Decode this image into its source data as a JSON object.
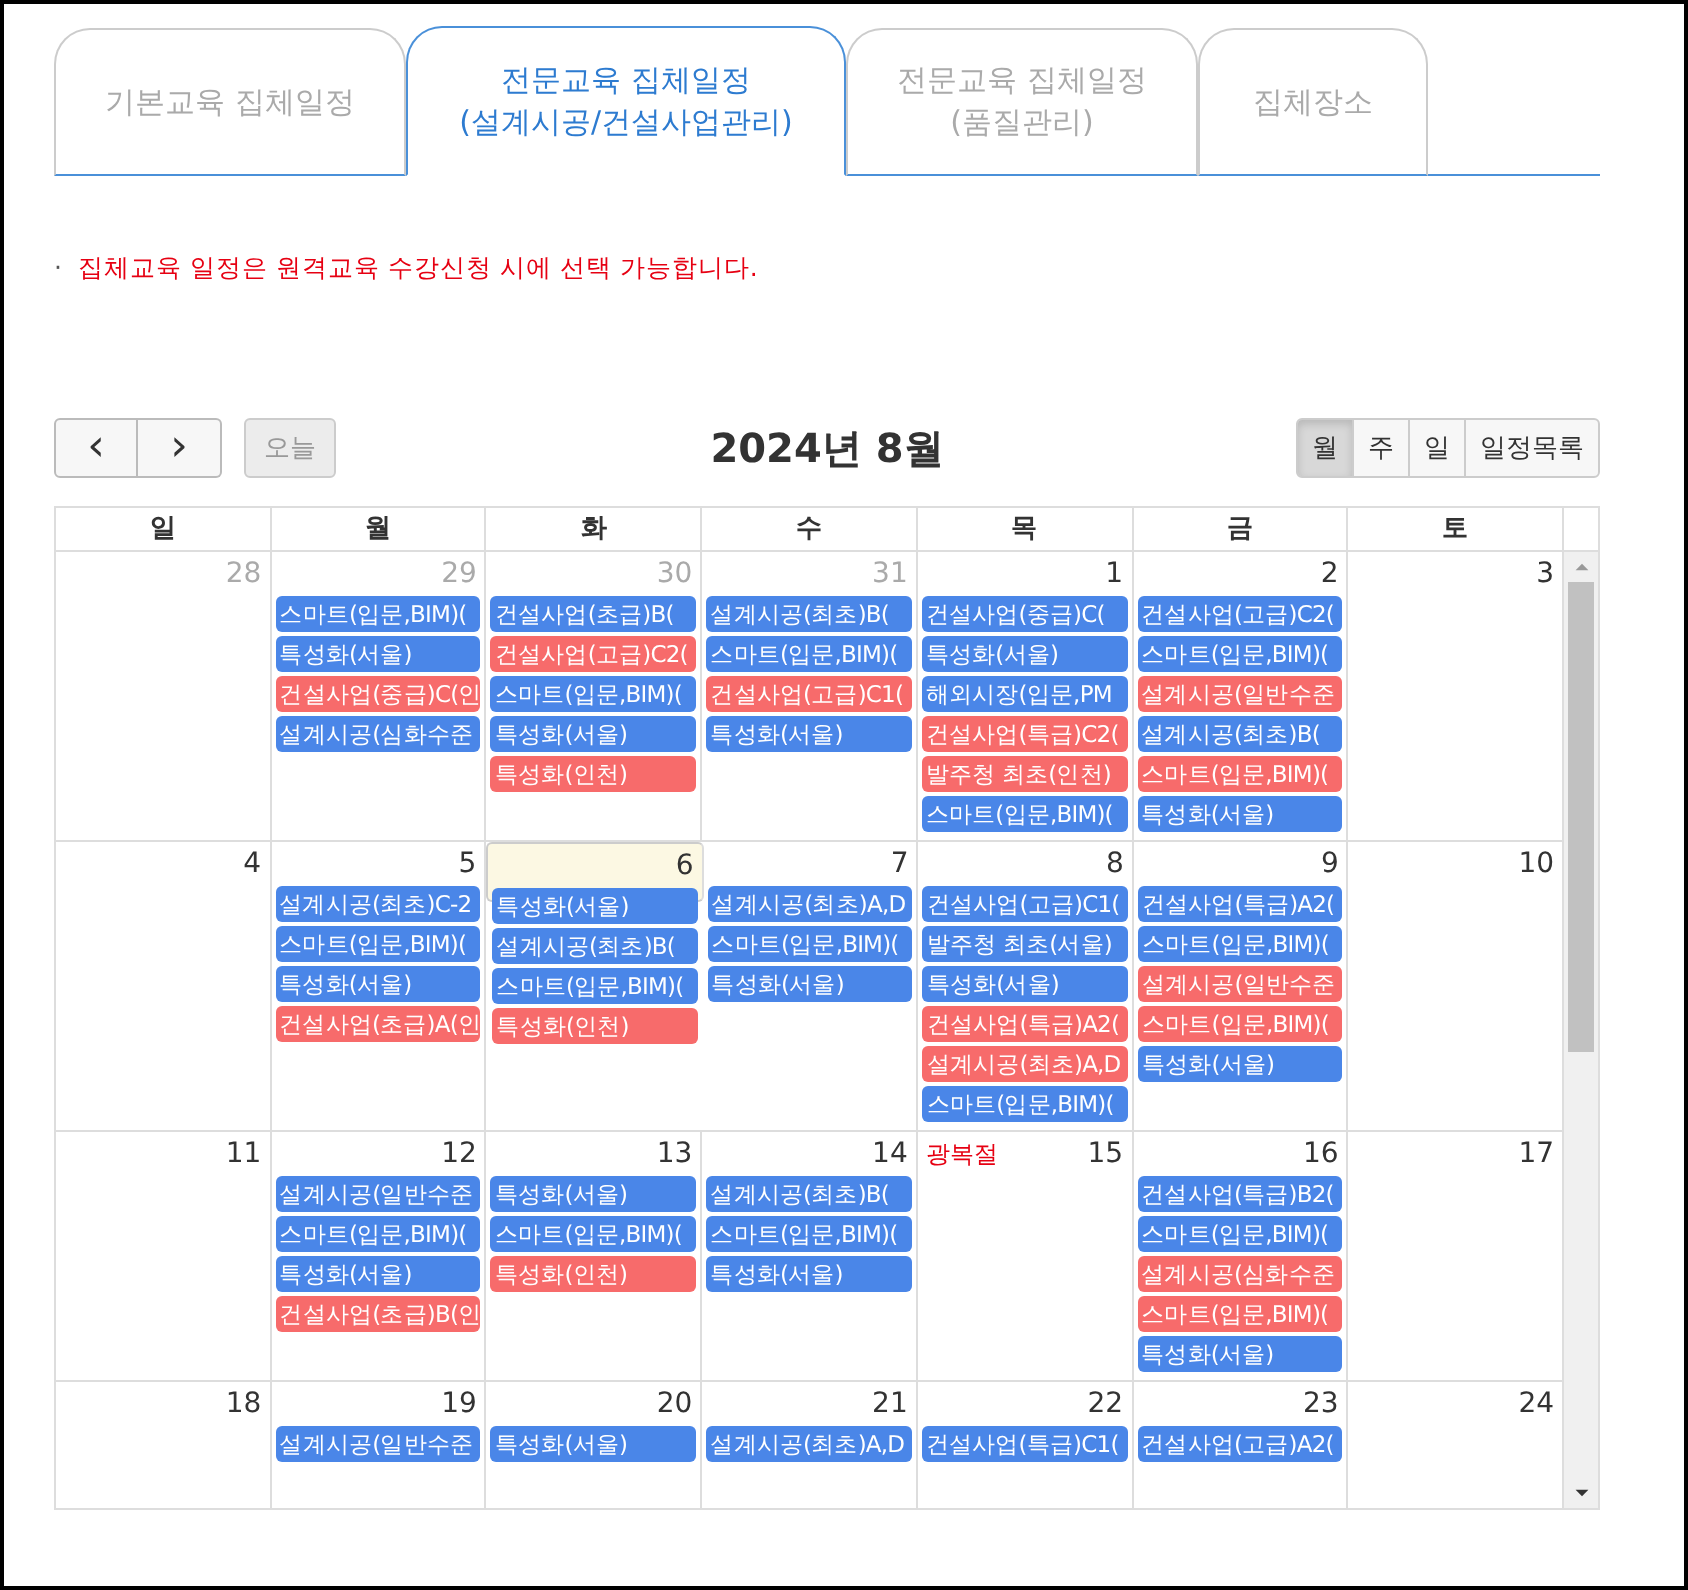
{
  "tabs": [
    {
      "lines": [
        "기본교육 집체일정"
      ],
      "selected": false
    },
    {
      "lines": [
        "전문교육 집체일정",
        "(설계시공/건설사업관리)"
      ],
      "selected": true
    },
    {
      "lines": [
        "전문교육 집체일정",
        "(품질관리)"
      ],
      "selected": false
    },
    {
      "lines": [
        "집체장소"
      ],
      "selected": false
    }
  ],
  "notice": {
    "bullet": "·",
    "text": "집체교육 일정은 원격교육 수강신청 시에 선택 가능합니다."
  },
  "toolbar": {
    "prev": "‹",
    "next": "›",
    "today": {
      "label": "오늘",
      "disabled": true
    },
    "title": "2024년 8월",
    "views": [
      {
        "label": "월",
        "selected": true
      },
      {
        "label": "주",
        "selected": false
      },
      {
        "label": "일",
        "selected": false
      },
      {
        "label": "일정목록",
        "selected": false
      }
    ]
  },
  "weekdays": [
    "일",
    "월",
    "화",
    "수",
    "목",
    "금",
    "토"
  ],
  "weeks": [
    {
      "days": [
        {
          "date": "28",
          "muted": true,
          "today": false
        },
        {
          "date": "29",
          "muted": true,
          "today": false,
          "events": [
            {
              "text": "스마트(입문,BIM)(",
              "color": "#4a86e8"
            },
            {
              "text": "특성화(서울)",
              "color": "#4a86e8"
            },
            {
              "text": "건설사업(중급)C(인",
              "color": "#f76b6b"
            },
            {
              "text": "설계시공(심화수준",
              "color": "#4a86e8"
            }
          ]
        },
        {
          "date": "30",
          "muted": true,
          "today": false,
          "events": [
            {
              "text": "건설사업(초급)B(",
              "color": "#4a86e8"
            },
            {
              "text": "건설사업(고급)C2(",
              "color": "#f76b6b"
            },
            {
              "text": "스마트(입문,BIM)(",
              "color": "#4a86e8"
            },
            {
              "text": "특성화(서울)",
              "color": "#4a86e8"
            },
            {
              "text": "특성화(인천)",
              "color": "#f76b6b"
            }
          ]
        },
        {
          "date": "31",
          "muted": true,
          "today": false,
          "events": [
            {
              "text": "설계시공(최초)B(",
              "color": "#4a86e8"
            },
            {
              "text": "스마트(입문,BIM)(",
              "color": "#4a86e8"
            },
            {
              "text": "건설사업(고급)C1(",
              "color": "#f76b6b"
            },
            {
              "text": "특성화(서울)",
              "color": "#4a86e8"
            }
          ]
        },
        {
          "date": "1",
          "muted": false,
          "today": false,
          "events": [
            {
              "text": "건설사업(중급)C(",
              "color": "#4a86e8"
            },
            {
              "text": "특성화(서울)",
              "color": "#4a86e8"
            },
            {
              "text": "해외시장(입문,PM",
              "color": "#4a86e8"
            },
            {
              "text": "건설사업(특급)C2(",
              "color": "#f76b6b"
            },
            {
              "text": "발주청 최초(인천)",
              "color": "#f76b6b"
            },
            {
              "text": "스마트(입문,BIM)(",
              "color": "#4a86e8"
            }
          ]
        },
        {
          "date": "2",
          "muted": false,
          "today": false,
          "events": [
            {
              "text": "건설사업(고급)C2(",
              "color": "#4a86e8"
            },
            {
              "text": "스마트(입문,BIM)(",
              "color": "#4a86e8"
            },
            {
              "text": "설계시공(일반수준",
              "color": "#f76b6b"
            },
            {
              "text": "설계시공(최초)B(",
              "color": "#4a86e8"
            },
            {
              "text": "스마트(입문,BIM)(",
              "color": "#f76b6b"
            },
            {
              "text": "특성화(서울)",
              "color": "#4a86e8"
            }
          ]
        },
        {
          "date": "3",
          "muted": false,
          "today": false
        }
      ]
    },
    {
      "days": [
        {
          "date": "4",
          "muted": false,
          "today": false
        },
        {
          "date": "5",
          "muted": false,
          "today": false,
          "events": [
            {
              "text": "설계시공(최초)C-2",
              "color": "#4a86e8"
            },
            {
              "text": "스마트(입문,BIM)(",
              "color": "#4a86e8"
            },
            {
              "text": "특성화(서울)",
              "color": "#4a86e8"
            },
            {
              "text": "건설사업(초급)A(인",
              "color": "#f76b6b"
            }
          ]
        },
        {
          "date": "6",
          "muted": false,
          "today": true,
          "events": [
            {
              "text": "특성화(서울)",
              "color": "#4a86e8"
            },
            {
              "text": "설계시공(최초)B(",
              "color": "#4a86e8"
            },
            {
              "text": "스마트(입문,BIM)(",
              "color": "#4a86e8"
            },
            {
              "text": "특성화(인천)",
              "color": "#f76b6b"
            }
          ]
        },
        {
          "date": "7",
          "muted": false,
          "today": false,
          "events": [
            {
              "text": "설계시공(최초)A,D",
              "color": "#4a86e8"
            },
            {
              "text": "스마트(입문,BIM)(",
              "color": "#4a86e8"
            },
            {
              "text": "특성화(서울)",
              "color": "#4a86e8"
            }
          ]
        },
        {
          "date": "8",
          "muted": false,
          "today": false,
          "events": [
            {
              "text": "건설사업(고급)C1(",
              "color": "#4a86e8"
            },
            {
              "text": "발주청 최초(서울)",
              "color": "#4a86e8"
            },
            {
              "text": "특성화(서울)",
              "color": "#4a86e8"
            },
            {
              "text": "건설사업(특급)A2(",
              "color": "#f76b6b"
            },
            {
              "text": "설계시공(최초)A,D",
              "color": "#f76b6b"
            },
            {
              "text": "스마트(입문,BIM)(",
              "color": "#4a86e8"
            }
          ]
        },
        {
          "date": "9",
          "muted": false,
          "today": false,
          "events": [
            {
              "text": "건설사업(특급)A2(",
              "color": "#4a86e8"
            },
            {
              "text": "스마트(입문,BIM)(",
              "color": "#4a86e8"
            },
            {
              "text": "설계시공(일반수준",
              "color": "#f76b6b"
            },
            {
              "text": "스마트(입문,BIM)(",
              "color": "#f76b6b"
            },
            {
              "text": "특성화(서울)",
              "color": "#4a86e8"
            }
          ]
        },
        {
          "date": "10",
          "muted": false,
          "today": false
        }
      ]
    },
    {
      "days": [
        {
          "date": "11",
          "muted": false,
          "today": false
        },
        {
          "date": "12",
          "muted": false,
          "today": false,
          "events": [
            {
              "text": "설계시공(일반수준",
              "color": "#4a86e8"
            },
            {
              "text": "스마트(입문,BIM)(",
              "color": "#4a86e8"
            },
            {
              "text": "특성화(서울)",
              "color": "#4a86e8"
            },
            {
              "text": "건설사업(초급)B(인",
              "color": "#f76b6b"
            }
          ]
        },
        {
          "date": "13",
          "muted": false,
          "today": false,
          "events": [
            {
              "text": "특성화(서울)",
              "color": "#4a86e8"
            },
            {
              "text": "스마트(입문,BIM)(",
              "color": "#4a86e8"
            },
            {
              "text": "특성화(인천)",
              "color": "#f76b6b"
            }
          ]
        },
        {
          "date": "14",
          "muted": false,
          "today": false,
          "events": [
            {
              "text": "설계시공(최초)B(",
              "color": "#4a86e8"
            },
            {
              "text": "스마트(입문,BIM)(",
              "color": "#4a86e8"
            },
            {
              "text": "특성화(서울)",
              "color": "#4a86e8"
            }
          ]
        },
        {
          "date": "15",
          "muted": false,
          "today": false,
          "holiday": "광복절"
        },
        {
          "date": "16",
          "muted": false,
          "today": false,
          "events": [
            {
              "text": "건설사업(특급)B2(",
              "color": "#4a86e8"
            },
            {
              "text": "스마트(입문,BIM)(",
              "color": "#4a86e8"
            },
            {
              "text": "설계시공(심화수준",
              "color": "#f76b6b"
            },
            {
              "text": "스마트(입문,BIM)(",
              "color": "#f76b6b"
            },
            {
              "text": "특성화(서울)",
              "color": "#4a86e8"
            }
          ]
        },
        {
          "date": "17",
          "muted": false,
          "today": false
        }
      ]
    },
    {
      "days": [
        {
          "date": "18",
          "muted": false,
          "today": false
        },
        {
          "date": "19",
          "muted": false,
          "today": false,
          "events": [
            {
              "text": "설계시공(일반수준",
              "color": "#4a86e8"
            }
          ]
        },
        {
          "date": "20",
          "muted": false,
          "today": false,
          "events": [
            {
              "text": "특성화(서울)",
              "color": "#4a86e8"
            }
          ]
        },
        {
          "date": "21",
          "muted": false,
          "today": false,
          "events": [
            {
              "text": "설계시공(최초)A,D",
              "color": "#4a86e8"
            }
          ]
        },
        {
          "date": "22",
          "muted": false,
          "today": false,
          "events": [
            {
              "text": "건설사업(특급)C1(",
              "color": "#4a86e8"
            }
          ]
        },
        {
          "date": "23",
          "muted": false,
          "today": false,
          "events": [
            {
              "text": "건설사업(고급)A2(",
              "color": "#4a86e8"
            }
          ]
        },
        {
          "date": "24",
          "muted": false,
          "today": false
        }
      ]
    }
  ]
}
